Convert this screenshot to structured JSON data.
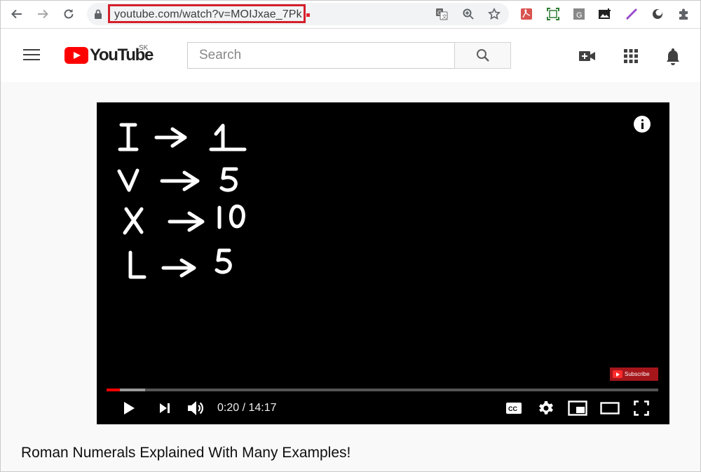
{
  "browser": {
    "url": "youtube.com/watch?v=MOIJxae_7Pk"
  },
  "youtube": {
    "logo_text": "YouTube",
    "region": "SK",
    "search_placeholder": "Search"
  },
  "video": {
    "board_lines": [
      {
        "left": "I",
        "right": "1"
      },
      {
        "left": "V",
        "right": "5"
      },
      {
        "left": "X",
        "right": "10"
      },
      {
        "left": "L",
        "right": "5"
      }
    ],
    "subscribe_label": "Subscribe",
    "time_display": "0:20 / 14:17",
    "progress_played": 0.024,
    "progress_buffered": 0.07,
    "title": "Roman Numerals Explained With Many Examples!"
  },
  "colors": {
    "brand": "#ff0000",
    "url_highlight": "#d41f2c"
  }
}
